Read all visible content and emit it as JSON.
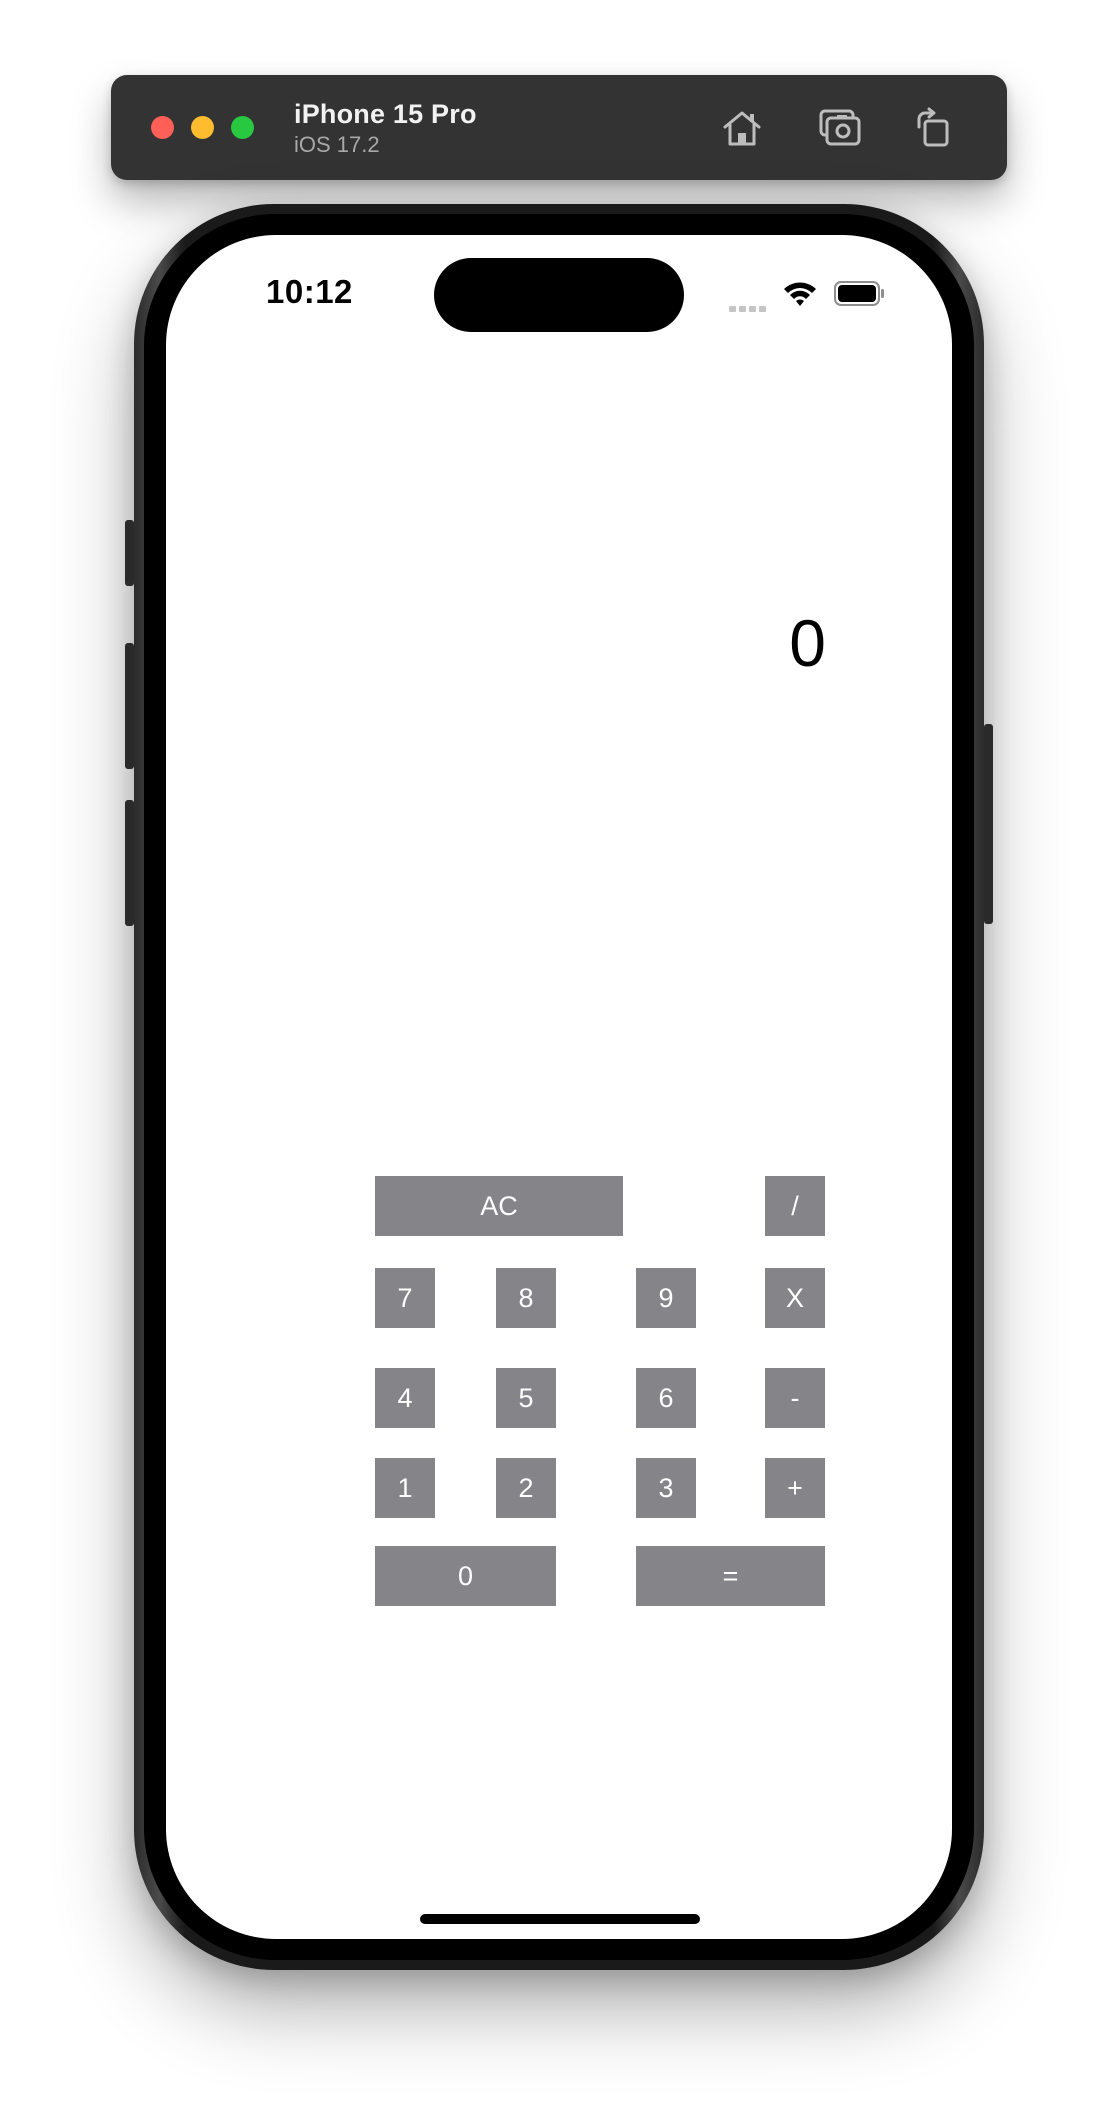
{
  "simulator": {
    "device_name": "iPhone 15 Pro",
    "os_version": "iOS 17.2",
    "toolbar_icons": [
      "home-icon",
      "screenshot-icon",
      "rotate-icon"
    ]
  },
  "status_bar": {
    "time": "10:12"
  },
  "calculator": {
    "display_value": "0",
    "buttons": {
      "ac": "AC",
      "divide": "/",
      "seven": "7",
      "eight": "8",
      "nine": "9",
      "multiply": "X",
      "four": "4",
      "five": "5",
      "six": "6",
      "minus": "-",
      "one": "1",
      "two": "2",
      "three": "3",
      "plus": "+",
      "zero": "0",
      "equals": "="
    },
    "button_color": "#858489",
    "button_text_color": "#ffffff"
  }
}
